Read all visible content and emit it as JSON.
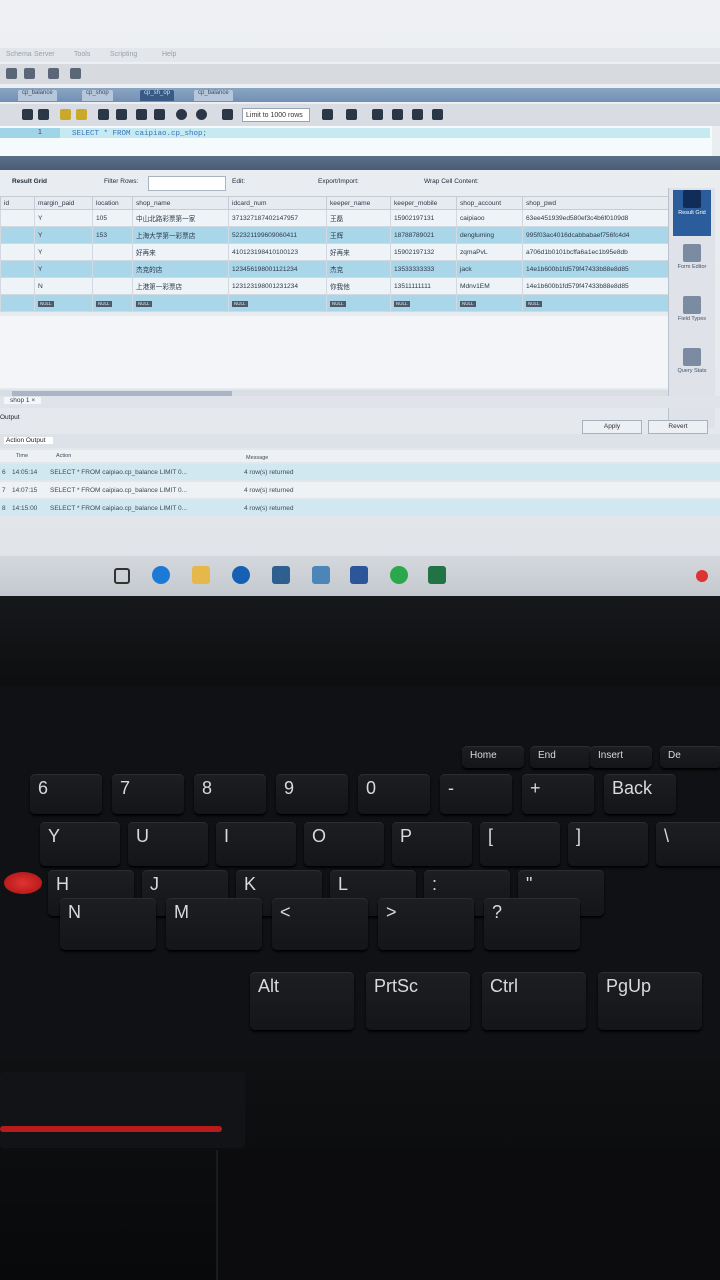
{
  "app": {
    "menu": [
      "Schema",
      "Server",
      "Tools",
      "Scripting",
      "Help"
    ],
    "tabs": [
      "cp_balance",
      "cp_shop",
      "cp_sh_op",
      "cp_balance"
    ],
    "active_tab_index": 2,
    "limit_select": "Limit to 1000 rows"
  },
  "editor": {
    "line_number": "1",
    "sql": "SELECT * FROM caipiao.cp_shop;"
  },
  "result_toolbar": {
    "label": "Result Grid",
    "filter_label": "Filter Rows:",
    "edit_label": "Edit:",
    "export_label": "Export/Import:",
    "wrap_label": "Wrap Cell Content:"
  },
  "grid": {
    "columns": [
      "id",
      "margin_paid",
      "location",
      "shop_name",
      "idcard_num",
      "keeper_name",
      "keeper_mobile",
      "shop_account",
      "shop_pwd"
    ],
    "rows": [
      [
        "",
        "Y",
        "105",
        "中山北路彩票第一家",
        "371327187402147957",
        "王磊",
        "15902197131",
        "caipiaoo",
        "63ee451939ed580ef3c4b6f0109d8"
      ],
      [
        "",
        "Y",
        "153",
        "上海大学第一彩票店",
        "522321199609060411",
        "王辉",
        "18788789021",
        "dengluming",
        "995f03ac4016dcabbabaef756fc4d4"
      ],
      [
        "",
        "Y",
        "",
        "好再来",
        "410123198410100123",
        "好再来",
        "15902197132",
        "zqmaPvL",
        "a706d1b0101bcffa6a1ec1b95e8db"
      ],
      [
        "",
        "Y",
        "",
        "杰克的店",
        "123456198001121234",
        "杰克",
        "13533333333",
        "jack",
        "14e1b600b1fd579f47433b88e8d85"
      ],
      [
        "",
        "N",
        "",
        "上港第一彩票店",
        "123123198001231234",
        "你我他",
        "13511111111",
        "Mdnv1EM",
        "14e1b600b1fd579f47433b88e8d85"
      ],
      [
        "",
        "NULL",
        "NULL",
        "NULL",
        "NULL",
        "NULL",
        "NULL",
        "NULL",
        "NULL"
      ]
    ]
  },
  "side_panel": [
    "Result Grid",
    "Form Editor",
    "Field Types",
    "Query Stats"
  ],
  "bottom": {
    "tab_label": "shop 1",
    "output_label": "Output",
    "output_select": "Action Output",
    "apply": "Apply",
    "revert": "Revert",
    "headers": [
      "Time",
      "Action",
      "Message"
    ],
    "rows": [
      {
        "n": "6",
        "time": "14:05:14",
        "action": "SELECT * FROM caipiao.cp_balance LIMIT 0...",
        "message": "4 row(s) returned"
      },
      {
        "n": "7",
        "time": "14:07:15",
        "action": "SELECT * FROM caipiao.cp_balance LIMIT 0...",
        "message": "4 row(s) returned"
      },
      {
        "n": "8",
        "time": "14:15:00",
        "action": "SELECT * FROM caipiao.cp_balance LIMIT 0...",
        "message": "4 row(s) returned"
      }
    ]
  },
  "keyboard": {
    "fn_row": [
      "Home",
      "End",
      "Insert",
      "De"
    ],
    "row_num": [
      "6",
      "7",
      "8",
      "9",
      "0",
      "-",
      "+",
      "Back"
    ],
    "row_top": [
      "Y",
      "U",
      "I",
      "O",
      "P",
      "[",
      "]",
      "\\"
    ],
    "row_home": [
      "H",
      "J",
      "K",
      "L",
      ":",
      "\""
    ],
    "row_bottom": [
      "N",
      "M",
      "<",
      ">",
      "?"
    ],
    "row_space": [
      "Alt",
      "PrtSc",
      "Ctrl",
      "PgUp"
    ]
  }
}
